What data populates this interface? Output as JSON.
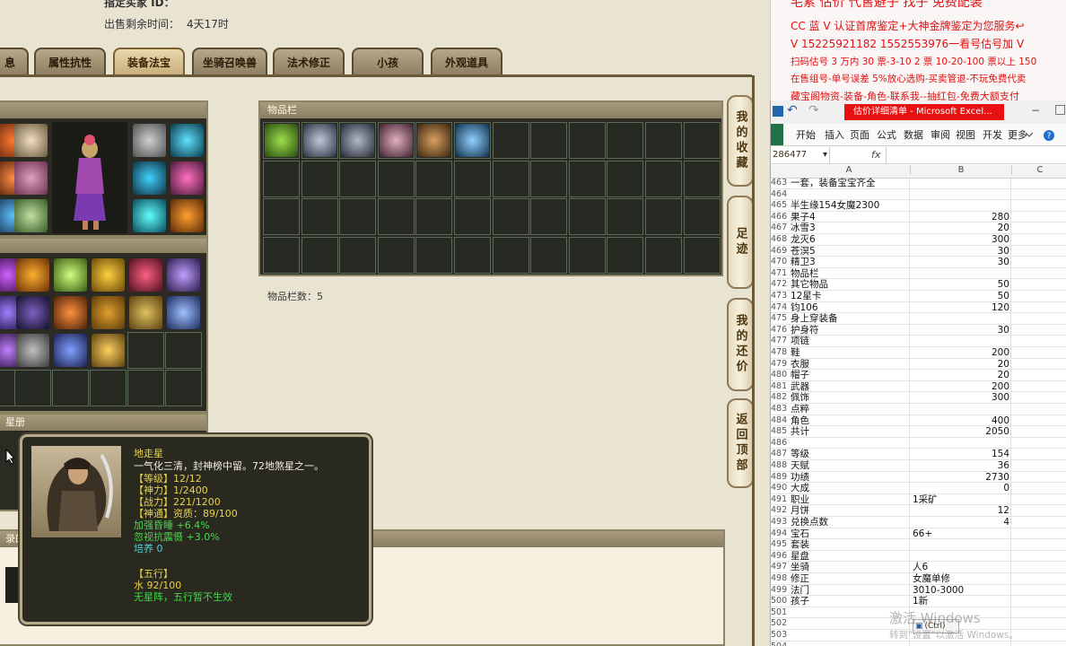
{
  "game": {
    "top_info": {
      "seller_label": "指定买家 ID：",
      "remaining_label": "出售剩余时间：",
      "remaining_value": "4天17时"
    },
    "tabs": [
      {
        "label": "息",
        "active": false
      },
      {
        "label": "属性抗性",
        "active": false
      },
      {
        "label": "装备法宝",
        "active": true
      },
      {
        "label": "坐骑召唤兽",
        "active": false
      },
      {
        "label": "法术修正",
        "active": false
      },
      {
        "label": "小孩",
        "active": false
      },
      {
        "label": "外观道具",
        "active": false
      }
    ],
    "inventory": {
      "title": "物品栏",
      "count_label": "物品栏数：5"
    },
    "section_stars_title": "星册",
    "section_bottom_title": "录的",
    "side_buttons": [
      {
        "label": "我的收藏"
      },
      {
        "label": "足迹"
      },
      {
        "label": "我的还价"
      },
      {
        "label": "返回顶部"
      }
    ],
    "tooltip": {
      "name": "地走星",
      "desc": "一气化三清，封神榜中留。72地煞星之一。",
      "level": "【等级】12/12",
      "power": "【神力】1/2400",
      "battle": "【战力】221/1200",
      "aptitude": "【神通】资质：89/100",
      "bonus1": "加强昏睡 +6.4%",
      "bonus2": "忽视抗震慑 +3.0%",
      "cultivate": "培养 0",
      "wuxing_title": "【五行】",
      "wuxing_value": "水 92/100",
      "star_array": "无星阵，五行暂不生效"
    },
    "colors": {
      "tooltip_yellow": "#e8d24a",
      "tooltip_white": "#f2efe2",
      "tooltip_green": "#43d84a",
      "tooltip_cyan": "#4fd2d8"
    }
  },
  "ad": {
    "lines": [
      "宅累 估价 代售避子 找子 免费配装",
      "CC 蓝 V 认证首席鉴定+大神金牌鉴定为您服务↩",
      "V 15225921182 1552553976一看号估号加 V",
      "扫码估号 3 万内 30 票-3-10 2 票 10-20-100 票以上 150",
      "在售组号-单号误差 5%放心选购-买卖管退-不玩免费代卖",
      "藏宝阁物资-装备-角色-联系我--抽红包-免费大额支付"
    ]
  },
  "excel": {
    "title": "估价详细清单 - Microsoft Excel...",
    "ribbon_tabs": [
      "开始",
      "插入",
      "页面",
      "公式",
      "数据",
      "审阅",
      "视图",
      "开发",
      "更多"
    ],
    "name_box": "286477",
    "fx": "fx",
    "col_headers": [
      "A",
      "B",
      "C"
    ],
    "rows": [
      {
        "n": "463",
        "a": "一套，装备宝宝齐全",
        "b": ""
      },
      {
        "n": "464",
        "a": "",
        "b": ""
      },
      {
        "n": "465",
        "a": "半生缘154女魔2300",
        "b": ""
      },
      {
        "n": "466",
        "a": "果子4",
        "b": "280"
      },
      {
        "n": "467",
        "a": "冰雪3",
        "b": "20"
      },
      {
        "n": "468",
        "a": "龙灭6",
        "b": "300"
      },
      {
        "n": "469",
        "a": "苍溟5",
        "b": "30"
      },
      {
        "n": "470",
        "a": "精卫3",
        "b": "30"
      },
      {
        "n": "471",
        "a": "物品栏",
        "b": ""
      },
      {
        "n": "472",
        "a": "其它物品",
        "b": "50"
      },
      {
        "n": "473",
        "a": "12星卡",
        "b": "50"
      },
      {
        "n": "474",
        "a": "钧106",
        "b": "120"
      },
      {
        "n": "475",
        "a": "身上穿装备",
        "b": ""
      },
      {
        "n": "476",
        "a": "护身符",
        "b": "30"
      },
      {
        "n": "477",
        "a": "项链",
        "b": ""
      },
      {
        "n": "478",
        "a": "鞋",
        "b": "200"
      },
      {
        "n": "479",
        "a": "衣服",
        "b": "20"
      },
      {
        "n": "480",
        "a": "帽子",
        "b": "20"
      },
      {
        "n": "481",
        "a": "武器",
        "b": "200"
      },
      {
        "n": "482",
        "a": "佩饰",
        "b": "300"
      },
      {
        "n": "483",
        "a": "点粹",
        "b": ""
      },
      {
        "n": "484",
        "a": "角色",
        "b": "400"
      },
      {
        "n": "485",
        "a": "共计",
        "b": "2050"
      },
      {
        "n": "486",
        "a": "",
        "b": ""
      },
      {
        "n": "487",
        "a": "等级",
        "b": "154"
      },
      {
        "n": "488",
        "a": "天赋",
        "b": "36"
      },
      {
        "n": "489",
        "a": "功绩",
        "b": "2730"
      },
      {
        "n": "490",
        "a": "大成",
        "b": "0"
      },
      {
        "n": "491",
        "a": "职业",
        "b": "1采矿"
      },
      {
        "n": "492",
        "a": "月饼",
        "b": "12"
      },
      {
        "n": "493",
        "a": "兑换点数",
        "b": "4"
      },
      {
        "n": "494",
        "a": "宝石",
        "b": "66+"
      },
      {
        "n": "495",
        "a": "套装",
        "b": ""
      },
      {
        "n": "496",
        "a": "星盘",
        "b": ""
      },
      {
        "n": "497",
        "a": "坐骑",
        "b": "人6"
      },
      {
        "n": "498",
        "a": "修正",
        "b": "女魔单修"
      },
      {
        "n": "499",
        "a": "法门",
        "b": "3010-3000"
      },
      {
        "n": "500",
        "a": "孩子",
        "b": "1新"
      },
      {
        "n": "501",
        "a": "",
        "b": ""
      },
      {
        "n": "502",
        "a": "",
        "b": ""
      },
      {
        "n": "503",
        "a": "",
        "b": ""
      },
      {
        "n": "504",
        "a": "",
        "b": ""
      }
    ],
    "paste_hint": "(Ctrl)",
    "watermark1": "激活 Windows",
    "watermark2": "转到\"设置\"以激活 Windows。"
  }
}
